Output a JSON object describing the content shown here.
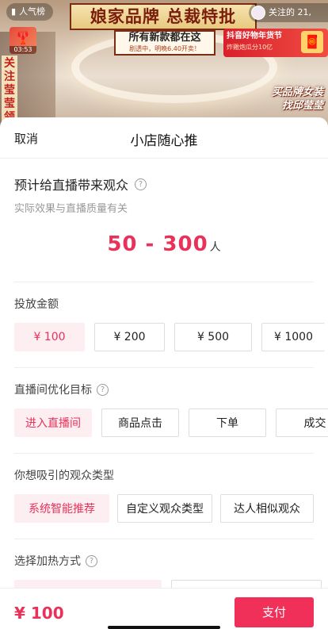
{
  "live": {
    "rank_label": "人气榜",
    "banner_title": "娘家品牌 总裁特批",
    "banner_line1": "所有新款都在这",
    "banner_line2": "剧透中，明晚6.40开卖！",
    "follow_text": "关注的 21,",
    "shop_fest_title": "抖音好物年货节",
    "shop_fest_sub": "炸雞炮瓜分10亿",
    "gift_icon": "gift-icon",
    "thumb_time": "03:53",
    "side_text": "关注莹莹领",
    "right_promo_line1": "买品牌女装",
    "right_promo_line2": "找邱莹莹"
  },
  "sheet": {
    "cancel_label": "取消",
    "title": "小店随心推",
    "estimate": {
      "title": "预计给直播带来观众",
      "subtitle": "实际效果与直播质量有关",
      "range": "50 - 300",
      "unit": "人"
    },
    "budget": {
      "label": "投放金额",
      "options": [
        "¥ 100",
        "¥ 200",
        "¥ 500",
        "¥ 1000"
      ],
      "selected_index": 0
    },
    "goal": {
      "label": "直播间优化目标",
      "options": [
        "进入直播间",
        "商品点击",
        "下单",
        "成交"
      ],
      "selected_index": 0
    },
    "audience": {
      "label": "你想吸引的观众类型",
      "options": [
        "系统智能推荐",
        "自定义观众类型",
        "达人相似观众"
      ],
      "selected_index": 0
    },
    "heating": {
      "label": "选择加热方式"
    }
  },
  "footer": {
    "price": "¥ 100",
    "pay_label": "支付"
  },
  "colors": {
    "accent": "#e8325a",
    "selected_bg": "#fdeef2",
    "pay_button": "#f1305a"
  }
}
